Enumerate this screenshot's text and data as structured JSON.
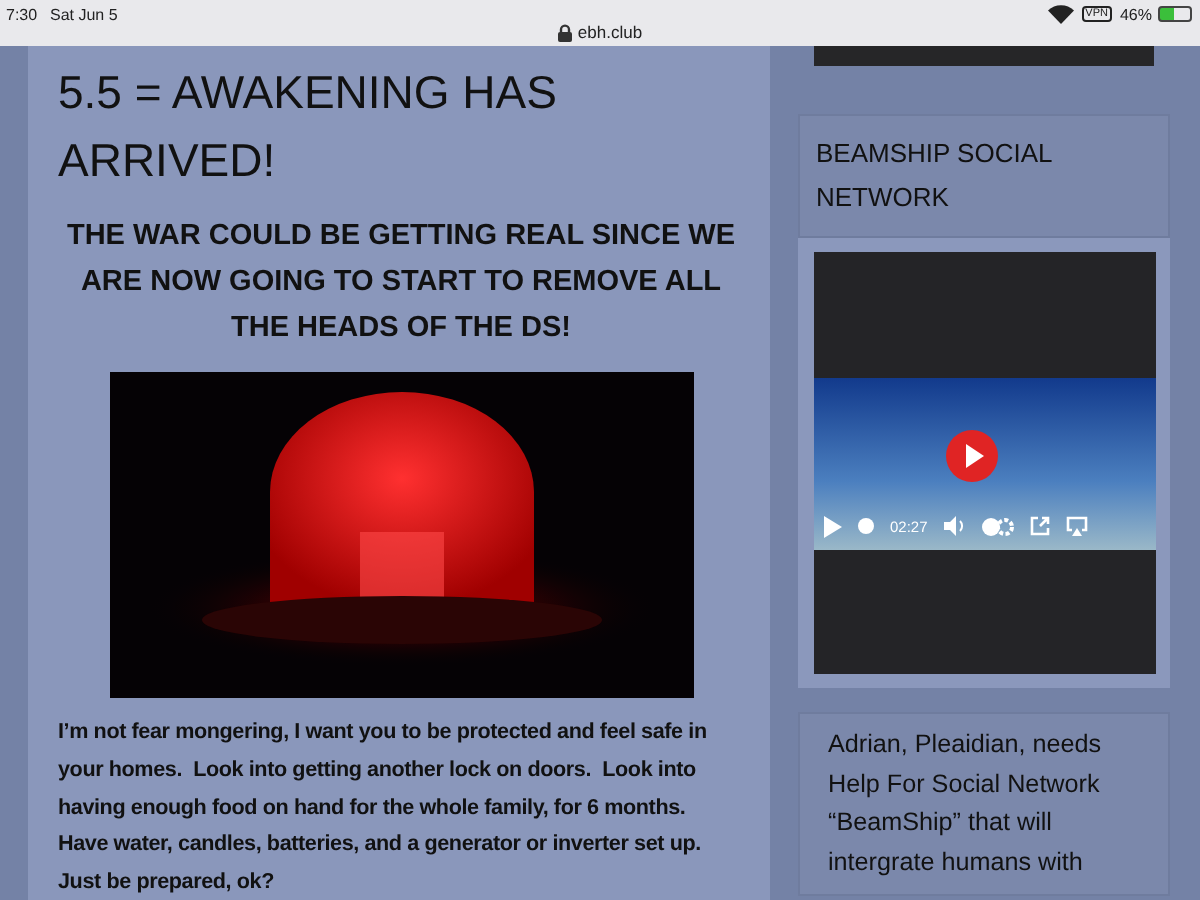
{
  "status_bar": {
    "time": "7:30",
    "date": "Sat Jun 5",
    "vpn": "VPN",
    "battery": "46%",
    "level": 0.46
  },
  "address_bar": {
    "url": "ebh.club"
  },
  "article": {
    "title": "5.5 = AWAKENING HAS ARRIVED!",
    "subtitle": "THE WAR COULD BE GETTING REAL SINCE WE ARE NOW GOING TO START TO REMOVE ALL THE HEADS OF THE DS!",
    "body": "I’m not fear mongering, I want you to be protected and feel safe in your homes.  Look into getting another lock on doors.  Look into having enough food on hand for the whole family, for 6 months.  Have water, candles, batteries, and a generator or inverter set up.  Just be prepared, ok?"
  },
  "sidebar": {
    "widget_title": "BEAMSHIP SOCIAL NETWORK",
    "video": {
      "time": "02:27"
    },
    "text": "Adrian, Pleaidian, needs Help For Social Network “BeamShip” that will intergrate humans with"
  }
}
